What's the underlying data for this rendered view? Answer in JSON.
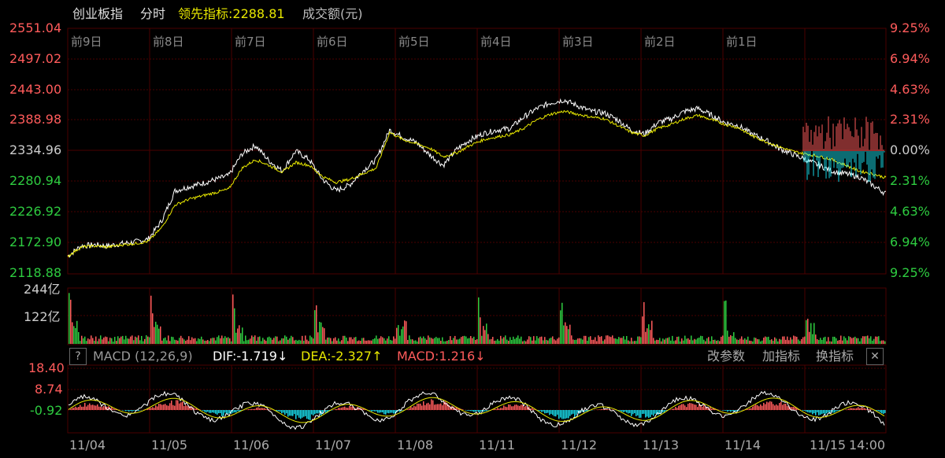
{
  "header": {
    "index_name": "创业板指",
    "period": "分时",
    "leader_label": "领先指标:2288.81",
    "volume_label": "成交额(元)"
  },
  "price_axis": {
    "left_ticks": [
      "2551.04",
      "2497.02",
      "2443.00",
      "2388.98",
      "2334.96",
      "2280.94",
      "2226.92",
      "2172.90",
      "2118.88"
    ],
    "right_ticks": [
      "9.25%",
      "6.94%",
      "4.63%",
      "2.31%",
      "0.00%",
      "2.31%",
      "4.63%",
      "6.94%",
      "9.25%"
    ]
  },
  "day_labels": [
    "前9日",
    "前8日",
    "前7日",
    "前6日",
    "前5日",
    "前4日",
    "前3日",
    "前2日",
    "前1日"
  ],
  "volume_axis": {
    "ticks": [
      "244亿",
      "122亿"
    ]
  },
  "macd": {
    "help": "?",
    "title": "MACD (12,26,9)",
    "dif": "DIF:-1.719↓",
    "dea": "DEA:-2.327↑",
    "macd": "MACD:1.216↓",
    "ticks": [
      "18.40",
      "8.74",
      "-0.92"
    ],
    "buttons": [
      "改参数",
      "加指标",
      "换指标"
    ],
    "close": "✕"
  },
  "dates": [
    "11/04",
    "11/05",
    "11/06",
    "11/07",
    "11/08",
    "11/11",
    "11/12",
    "11/13",
    "11/14",
    "11/15",
    "14:00"
  ],
  "colors": {
    "up": "#ff5b5b",
    "down": "#2ecc40",
    "price": "#ffffff",
    "avg": "#e8e800",
    "cyan": "#19d7e6",
    "grid": "#4a0000",
    "text": "#cccccc"
  },
  "chart_data": {
    "type": "line",
    "ylim": [
      2118.88,
      2551.04
    ],
    "base": 2334.96,
    "series": [
      {
        "values": [
          2150,
          2168,
          2170,
          2168,
          2172,
          2175,
          2180,
          2212,
          2265,
          2272,
          2278,
          2285,
          2292,
          2330,
          2345,
          2318,
          2300,
          2335,
          2320,
          2285,
          2265,
          2275,
          2300,
          2320,
          2372,
          2360,
          2350,
          2328,
          2310,
          2338,
          2355,
          2366,
          2372,
          2375,
          2395,
          2410,
          2420,
          2425,
          2415,
          2405,
          2402,
          2390,
          2372,
          2365,
          2385,
          2392,
          2405,
          2410,
          2398,
          2385,
          2380,
          2365,
          2355,
          2340,
          2330,
          2320,
          2310,
          2300,
          2295,
          2290,
          2275,
          2260
        ]
      },
      {
        "values": [
          2150,
          2166,
          2168,
          2166,
          2170,
          2172,
          2176,
          2200,
          2240,
          2250,
          2256,
          2262,
          2268,
          2305,
          2320,
          2310,
          2298,
          2315,
          2310,
          2290,
          2280,
          2285,
          2295,
          2305,
          2368,
          2355,
          2348,
          2340,
          2325,
          2332,
          2345,
          2355,
          2360,
          2364,
          2375,
          2390,
          2400,
          2405,
          2400,
          2395,
          2392,
          2380,
          2368,
          2362,
          2375,
          2382,
          2392,
          2398,
          2390,
          2382,
          2376,
          2362,
          2352,
          2343,
          2335,
          2330,
          2326,
          2320,
          2310,
          2300,
          2295,
          2288
        ]
      }
    ]
  }
}
